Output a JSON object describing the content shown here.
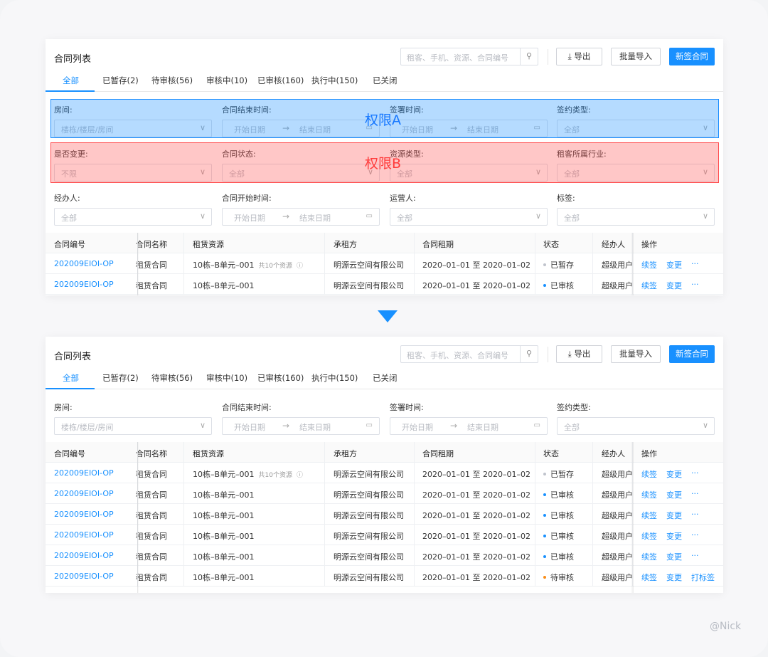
{
  "header": {
    "title": "合同列表",
    "search_placeholder": "租客、手机、资源、合同编号",
    "export": "导出",
    "batch_import": "批量导入",
    "new_contract": "新签合同"
  },
  "tabs": [
    "全部",
    "已暂存(2)",
    "待审核(56)",
    "审核中(10)",
    "已审核(160)",
    "执行中(150)",
    "已关闭"
  ],
  "filters": {
    "room_label": "房间:",
    "room_ph": "楼栋/楼层/房间",
    "end_label": "合同结束时间:",
    "start_date": "开始日期",
    "end_date": "结束日期",
    "sign_time_label": "签署时间:",
    "sign_type_label": "签约类型:",
    "all": "全部",
    "changed_label": "是否变更:",
    "changed_ph": "不限",
    "status_label": "合同状态:",
    "resource_type_label": "资源类型:",
    "industry_label": "租客所属行业:",
    "handler_label": "经办人:",
    "begin_label": "合同开始时间:",
    "operator_label": "运营人:",
    "tag_label": "标签:"
  },
  "overlays": {
    "a": "权限A",
    "b": "权限B"
  },
  "table": {
    "headers": [
      "合同编号",
      "合同名称",
      "租赁资源",
      "承租方",
      "合同租期",
      "状态",
      "经办人",
      "操作"
    ],
    "rows": [
      {
        "id": "202009EIOI-OP",
        "name": "租赁合同",
        "res": "10栋–B单元–001",
        "res_note": "共10个资源",
        "tenant": "明源云空间有限公司",
        "period": "2020–01–01 至 2020–01–02",
        "status": "已暂存",
        "status_color": "#c0c4cc",
        "handler": "超级用户",
        "op1": "续签",
        "op2": "变更",
        "op3": "···"
      },
      {
        "id": "202009EIOI-OP",
        "name": "租赁合同",
        "res": "10栋–B单元–001",
        "res_note": "",
        "tenant": "明源云空间有限公司",
        "period": "2020–01–01 至 2020–01–02",
        "status": "已审核",
        "status_color": "#1890ff",
        "handler": "超级用户",
        "op1": "续签",
        "op2": "变更",
        "op3": "···"
      },
      {
        "id": "202009EIOI-OP",
        "name": "租赁合同",
        "res": "10栋–B单元–001",
        "res_note": "",
        "tenant": "明源云空间有限公司",
        "period": "2020–01–01 至 2020–01–02",
        "status": "已审核",
        "status_color": "#1890ff",
        "handler": "超级用户",
        "op1": "续签",
        "op2": "变更",
        "op3": "···"
      },
      {
        "id": "202009EIOI-OP",
        "name": "租赁合同",
        "res": "10栋–B单元–001",
        "res_note": "",
        "tenant": "明源云空间有限公司",
        "period": "2020–01–01 至 2020–01–02",
        "status": "已审核",
        "status_color": "#1890ff",
        "handler": "超级用户",
        "op1": "续签",
        "op2": "变更",
        "op3": "···"
      },
      {
        "id": "202009EIOI-OP",
        "name": "租赁合同",
        "res": "10栋–B单元–001",
        "res_note": "",
        "tenant": "明源云空间有限公司",
        "period": "2020–01–01 至 2020–01–02",
        "status": "已审核",
        "status_color": "#1890ff",
        "handler": "超级用户",
        "op1": "续签",
        "op2": "变更",
        "op3": "···"
      },
      {
        "id": "202009EIOI-OP",
        "name": "租赁合同",
        "res": "10栋–B单元–001",
        "res_note": "",
        "tenant": "明源云空间有限公司",
        "period": "2020–01–01 至 2020–01–02",
        "status": "待审核",
        "status_color": "#fa8c16",
        "handler": "超级用户",
        "op1": "续签",
        "op2": "变更",
        "op3": "打标签"
      }
    ]
  },
  "watermark": "@Nick"
}
